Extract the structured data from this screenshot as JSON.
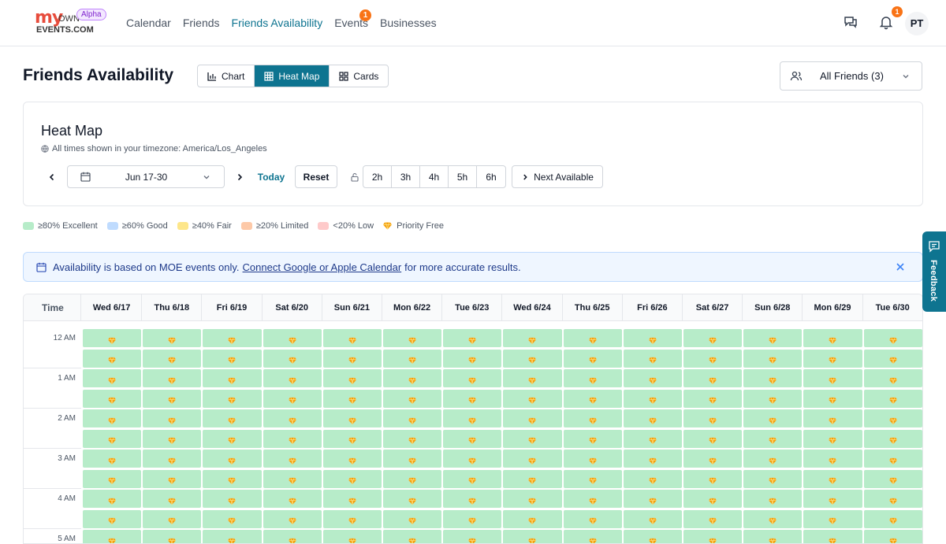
{
  "header": {
    "logo_text": "myOWN EVENTS.COM",
    "logo_my": "my",
    "logo_own": "OWN",
    "logo_events": "EVENTS.COM",
    "alpha": "Alpha",
    "nav": [
      {
        "label": "Calendar"
      },
      {
        "label": "Friends"
      },
      {
        "label": "Friends Availability"
      },
      {
        "label": "Events",
        "badge": "1"
      },
      {
        "label": "Businesses"
      }
    ],
    "bell_badge": "1",
    "avatar": "PT"
  },
  "page": {
    "title": "Friends Availability",
    "views": [
      "Chart",
      "Heat Map",
      "Cards"
    ],
    "active_view": "Heat Map",
    "friends_filter": "All Friends (3)"
  },
  "panel": {
    "title": "Heat Map",
    "timezone_note": "All times shown in your timezone: America/Los_Angeles",
    "date_range": "Jun 17-30",
    "today": "Today",
    "reset": "Reset",
    "durations": [
      "2h",
      "3h",
      "4h",
      "5h",
      "6h"
    ],
    "next_available": "Next Available"
  },
  "legend": [
    {
      "label": "≥80% Excellent",
      "color": "#b7ecc9"
    },
    {
      "label": "≥60% Good",
      "color": "#bfdbfe"
    },
    {
      "label": "≥40% Fair",
      "color": "#fde68a"
    },
    {
      "label": "≥20% Limited",
      "color": "#fdc9a8"
    },
    {
      "label": "<20% Low",
      "color": "#fecaca"
    },
    {
      "label": "Priority Free",
      "icon": "gem-icon"
    }
  ],
  "notice": {
    "before": "Availability is based on MOE events only.",
    "link": "Connect Google or Apple Calendar",
    "after": "for more accurate results."
  },
  "grid": {
    "time_header": "Time",
    "days": [
      "Wed 6/17",
      "Thu 6/18",
      "Fri 6/19",
      "Sat 6/20",
      "Sun 6/21",
      "Mon 6/22",
      "Tue 6/23",
      "Wed 6/24",
      "Thu 6/25",
      "Fri 6/26",
      "Sat 6/27",
      "Sun 6/28",
      "Mon 6/29",
      "Tue 6/30"
    ],
    "hours": [
      "12 AM",
      "1 AM",
      "2 AM",
      "3 AM",
      "4 AM",
      "5 AM"
    ],
    "visible_slots": 11,
    "cell_level": "excellent",
    "cell_color": "#b7ecc9",
    "priority_free": true
  },
  "feedback": "Feedback",
  "colors": {
    "accent": "#0e7490",
    "badge": "#f97316"
  }
}
